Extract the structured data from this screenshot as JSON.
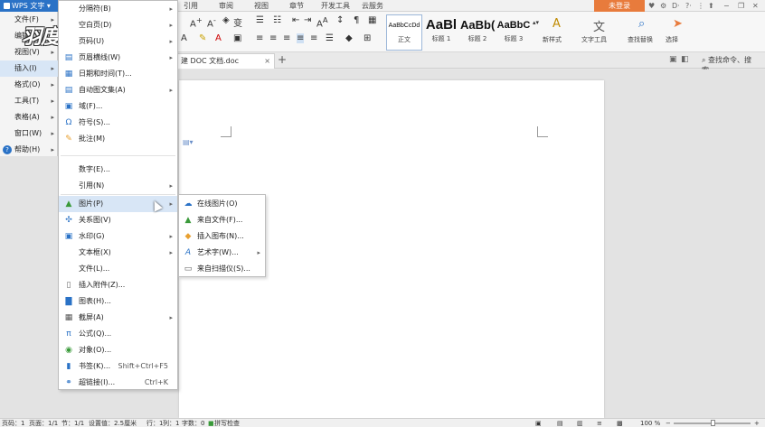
{
  "titlebar": {
    "app_button": "WPS 文字",
    "tabs": [
      "引用",
      "审阅",
      "视图",
      "章节",
      "开发工具",
      "云服务"
    ],
    "login": "未登录"
  },
  "ribbon": {
    "styles": [
      {
        "preview": "AaBbCcDd",
        "label": "正文"
      },
      {
        "preview": "AaBl",
        "label": "标题 1"
      },
      {
        "preview": "AaBb(",
        "label": "标题 2"
      },
      {
        "preview": "AaBbC",
        "label": "标题 3"
      }
    ],
    "new_style": "新样式",
    "text_tools": "文字工具",
    "find_replace": "查找替换",
    "select": "选择"
  },
  "docbar": {
    "tab_title": "建 DOC 文档.doc",
    "search_placeholder": "查找命令、搜索..."
  },
  "main_menu": {
    "items": [
      {
        "label": "文件(F)"
      },
      {
        "label": "编辑"
      },
      {
        "label": "视图(V)"
      },
      {
        "label": "插入(I)"
      },
      {
        "label": "格式(O)"
      },
      {
        "label": "工具(T)"
      },
      {
        "label": "表格(A)"
      },
      {
        "label": "窗口(W)"
      },
      {
        "label": "帮助(H)"
      }
    ]
  },
  "watermark": "羽度视频",
  "insert_menu": {
    "items": [
      {
        "label": "分隔符(B)"
      },
      {
        "label": "空白页(D)"
      },
      {
        "label": "页码(U)"
      },
      {
        "label": "页眉横线(W)"
      },
      {
        "label": "日期和时间(T)..."
      },
      {
        "label": "自动图文集(A)"
      },
      {
        "label": "域(F)..."
      },
      {
        "label": "符号(S)..."
      },
      {
        "label": "批注(M)"
      },
      {
        "label": "数字(E)..."
      },
      {
        "label": "引用(N)"
      },
      {
        "label": "图片(P)"
      },
      {
        "label": "关系图(V)"
      },
      {
        "label": "水印(G)"
      },
      {
        "label": "文本框(X)"
      },
      {
        "label": "文件(L)..."
      },
      {
        "label": "插入附件(Z)..."
      },
      {
        "label": "图表(H)..."
      },
      {
        "label": "截屏(A)"
      },
      {
        "label": "公式(Q)..."
      },
      {
        "label": "对象(O)..."
      },
      {
        "label": "书签(K)...",
        "shortcut": "Shift+Ctrl+F5"
      },
      {
        "label": "超链接(I)...",
        "shortcut": "Ctrl+K"
      }
    ]
  },
  "picture_menu": {
    "items": [
      {
        "label": "在线图片(O)"
      },
      {
        "label": "来自文件(F)..."
      },
      {
        "label": "插入图布(N)..."
      },
      {
        "label": "艺术字(W)..."
      },
      {
        "label": "来自扫描仪(S)..."
      }
    ]
  },
  "statusbar": {
    "page": "页码：1",
    "pages": "页面：1/1",
    "section": "节：1/1",
    "position": "设置值：2.5厘米",
    "row": "行：1",
    "col": "列：1",
    "words": "字数：0",
    "spell": "拼写检查",
    "zoom": "100 %"
  },
  "colors": {
    "accent": "#2a72c6",
    "login": "#e87b3c",
    "menu_hover": "#d8e6f6"
  }
}
